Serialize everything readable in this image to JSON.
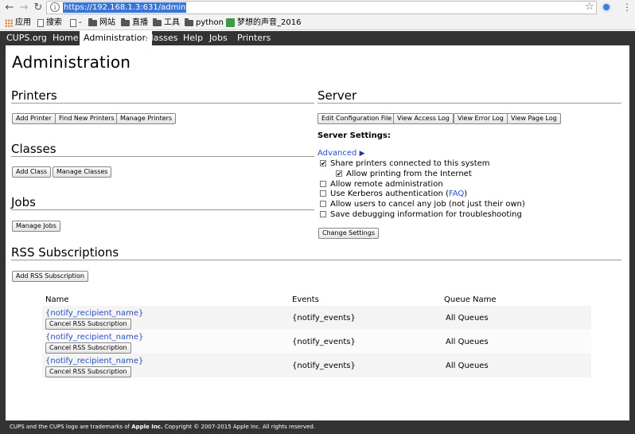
{
  "browser": {
    "url": "https://192.168.1.3:631/admin",
    "bookmarks": [
      {
        "label": "应用",
        "icon": "apps-grid-icon"
      },
      {
        "label": "搜索",
        "icon": "page-icon"
      },
      {
        "label": "-",
        "icon": "page-icon"
      },
      {
        "label": "网站",
        "icon": "folder-icon"
      },
      {
        "label": "直播",
        "icon": "folder-icon"
      },
      {
        "label": "工具",
        "icon": "folder-icon"
      },
      {
        "label": "python",
        "icon": "folder-icon"
      },
      {
        "label": "梦想的声音_2016",
        "icon": "green-tile-icon"
      }
    ]
  },
  "nav": {
    "tabs": [
      "CUPS.org",
      "Home",
      "Administration",
      "Classes",
      "Help",
      "Jobs",
      "Printers"
    ],
    "active": "Administration"
  },
  "page": {
    "title": "Administration",
    "printers": {
      "heading": "Printers",
      "buttons": [
        "Add Printer",
        "Find New Printers",
        "Manage Printers"
      ]
    },
    "classes": {
      "heading": "Classes",
      "buttons": [
        "Add Class",
        "Manage Classes"
      ]
    },
    "jobs": {
      "heading": "Jobs",
      "buttons": [
        "Manage Jobs"
      ]
    },
    "server": {
      "heading": "Server",
      "buttons": [
        "Edit Configuration File",
        "View Access Log",
        "View Error Log",
        "View Page Log"
      ],
      "settings_label": "Server Settings:",
      "advanced": "Advanced",
      "advanced_arrow": "▶",
      "options": [
        {
          "label": "Share printers connected to this system",
          "checked": true
        },
        {
          "label": "Allow printing from the Internet",
          "checked": true
        },
        {
          "label": "Allow remote administration",
          "checked": false
        },
        {
          "label": "Use Kerberos authentication (",
          "link": "FAQ",
          "suffix": ")",
          "checked": false
        },
        {
          "label": "Allow users to cancel any job (not just their own)",
          "checked": false
        },
        {
          "label": "Save debugging information for troubleshooting",
          "checked": false
        }
      ],
      "change_button": "Change Settings"
    },
    "rss": {
      "heading": "RSS Subscriptions",
      "add_button": "Add RSS Subscription",
      "columns": [
        "Name",
        "Events",
        "Queue Name"
      ],
      "rows": [
        {
          "name": "{notify_recipient_name}",
          "cancel": "Cancel RSS Subscription",
          "events": "{notify_events}",
          "queue": "All Queues"
        },
        {
          "name": "{notify_recipient_name}",
          "cancel": "Cancel RSS Subscription",
          "events": "{notify_events}",
          "queue": "All Queues"
        },
        {
          "name": "{notify_recipient_name}",
          "cancel": "Cancel RSS Subscription",
          "events": "{notify_events}",
          "queue": "All Queues"
        }
      ]
    }
  },
  "footer": {
    "pre": "CUPS and the CUPS logo are trademarks of ",
    "brand": "Apple Inc.",
    "post": " Copyright © 2007-2015 Apple Inc. All rights reserved."
  }
}
